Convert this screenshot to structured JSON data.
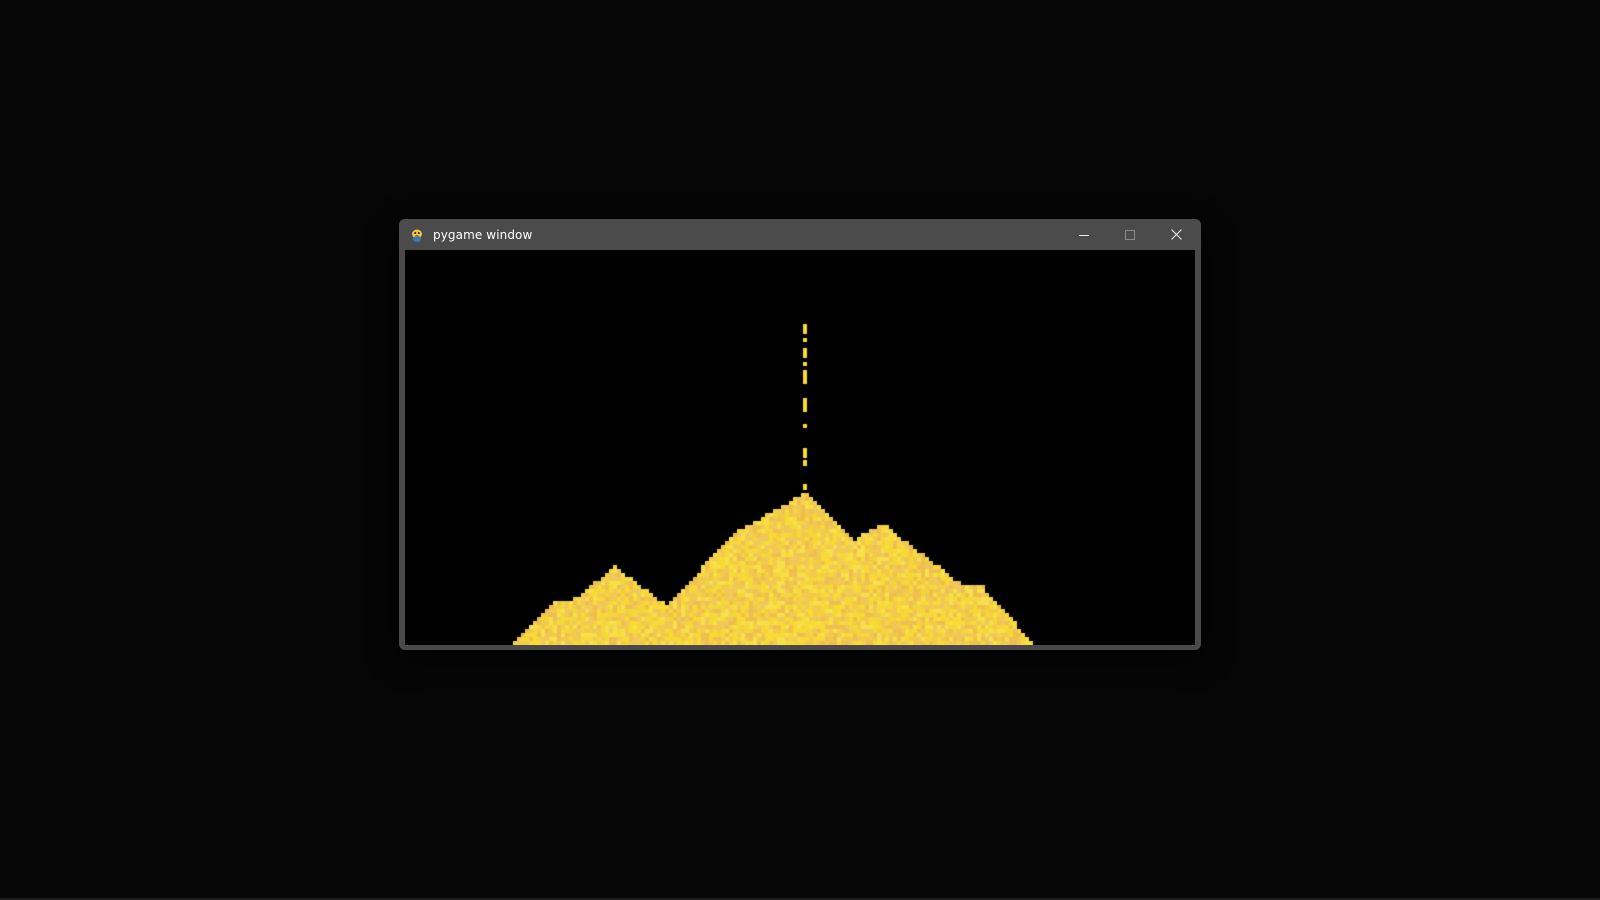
{
  "window": {
    "title": "pygame window",
    "icon": "pygame-snake-icon"
  },
  "caption_buttons": {
    "minimize": "minimize-icon",
    "maximize": "maximize-icon",
    "close": "close-icon"
  },
  "scene": {
    "background_color": "#000000",
    "sand_colors": [
      "#f5d63a",
      "#f2c94a",
      "#f7e04b",
      "#eebf4f",
      "#f9da34",
      "#f0c85c"
    ],
    "falling_stream_color": "#f9dc2c"
  }
}
